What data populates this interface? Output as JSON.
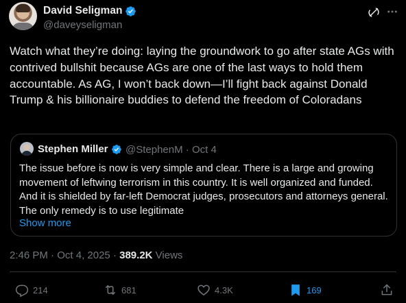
{
  "author": {
    "display_name": "David Seligman",
    "handle": "@daveyseligman"
  },
  "tweet": {
    "text": "Watch what they’re doing: laying the groundwork to go after state AGs with contrived bullshit because AGs are one of the last ways to hold them accountable. As AG, I won’t back down—I’ll fight back against Donald Trump & his billionaire buddies to defend the freedom of Coloradans"
  },
  "quote": {
    "display_name": "Stephen Miller",
    "handle": "@StephenM",
    "separator": "·",
    "date": "Oct 4",
    "text": "The issue before is now is very simple and clear. There is a large and growing movement of leftwing terrorism in this country. It is well organized and funded. And it is shielded by far-left Democrat judges, prosecutors and attorneys general. The only remedy is to use legitimate",
    "show_more": "Show more"
  },
  "meta": {
    "time": "2:46 PM",
    "separator1": "·",
    "date": "Oct 4, 2025",
    "separator2": "·",
    "views_count": "389.2K",
    "views_label": "Views"
  },
  "actions": {
    "replies": "214",
    "reposts": "681",
    "likes": "4.3K",
    "bookmarks": "169"
  },
  "colors": {
    "background": "#000000",
    "text": "#e7e9ea",
    "muted": "#71767b",
    "accent": "#1d9bf0",
    "border": "#2f3336"
  },
  "icons": [
    "verified-badge-icon",
    "grok-icon",
    "more-icon",
    "reply-icon",
    "repost-icon",
    "like-icon",
    "bookmark-icon",
    "share-icon"
  ]
}
